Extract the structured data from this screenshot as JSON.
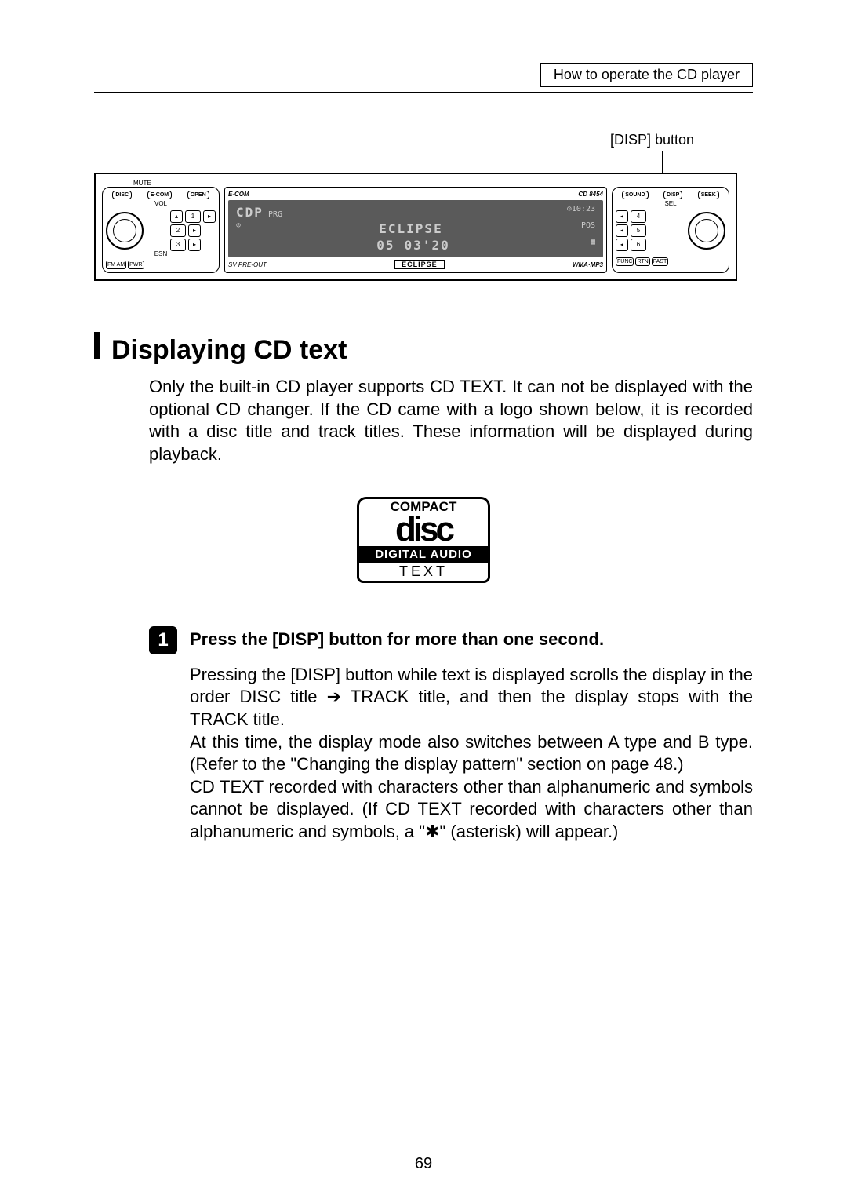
{
  "header": {
    "breadcrumb": "How to operate the CD player"
  },
  "callout": {
    "disp_button": "[DISP] button"
  },
  "diagram": {
    "mute": "MUTE",
    "disc_btn": "DISC",
    "ecom_btn": "E-COM",
    "open_btn": "OPEN",
    "vol": "VOL",
    "audio_mode": "",
    "esn": "ESN",
    "fm_am": "FM\nAM",
    "pwr": "PWR",
    "presets_left": [
      "1",
      "2",
      "3"
    ],
    "preset_sym_left": [
      "▴",
      "▸",
      "▸"
    ],
    "presets_right": [
      "4",
      "5",
      "6"
    ],
    "preset_sym_right": [
      "◂",
      "◂",
      "◂"
    ],
    "brand": "E-COM",
    "model": "CD 8454",
    "lcd": {
      "line1_left": "CDP",
      "line1_sub": "PRG",
      "line1_right": "⊙10:23",
      "line2_center": "ECLIPSE",
      "line2_right": "POS",
      "line3_left": "05",
      "line3_center": "03'20"
    },
    "sv": "SV PRE-OUT",
    "wma": "WMA·MP3",
    "eclipse": "ECLIPSE",
    "sound_btn": "SOUND",
    "disp_btn": "DISP",
    "seek_btn": "SEEK",
    "sel": "SEL",
    "func_btn": "FUNC",
    "rtn_btn": "RTN",
    "fast_btn": "FAST"
  },
  "section": {
    "title": "Displaying CD text",
    "body": "Only the built-in CD player supports CD TEXT. It can not be displayed with the optional CD changer. If the CD came with a logo shown below, it is recorded with a disc title and track titles. These information will be displayed during playback."
  },
  "cd_logo": {
    "compact": "COMPACT",
    "disc": "disc",
    "digital": "DIGITAL AUDIO",
    "text": "TEXT"
  },
  "step": {
    "num": "1",
    "title": "Press the [DISP] button for more than one second.",
    "body": "Pressing the [DISP] button while text is displayed scrolls the display in the order DISC title ➔ TRACK title, and then the display stops with the TRACK title.\nAt this time, the display mode also switches between A type and B type. (Refer to the \"Changing the display pattern\" section on page 48.)\nCD TEXT recorded with characters other than alphanumeric and symbols cannot be displayed. (If CD TEXT recorded with characters other than alphanumeric and symbols, a \"✱\" (asterisk) will appear.)"
  },
  "page_number": "69"
}
